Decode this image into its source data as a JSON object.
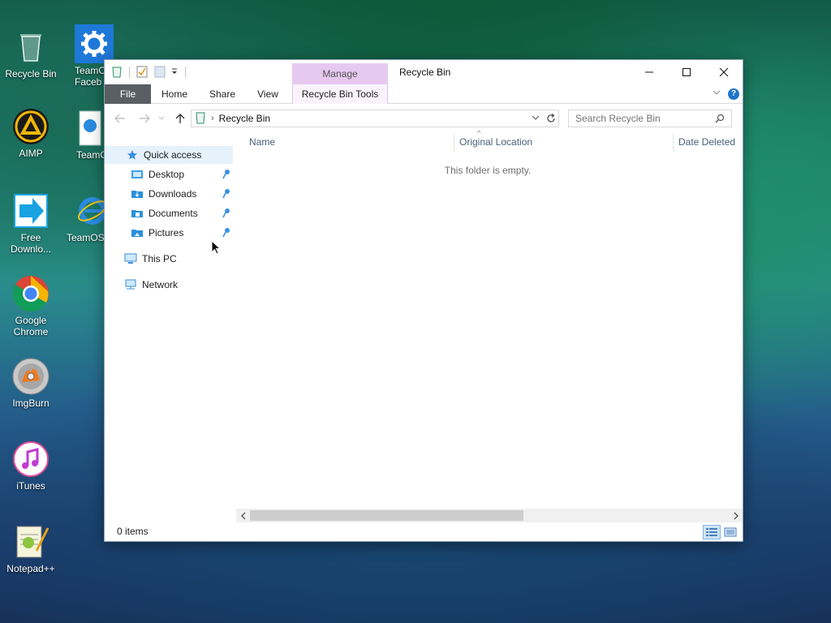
{
  "desktop": {
    "icons": [
      {
        "label": "Recycle Bin"
      },
      {
        "label": "TeamO\nFaceb"
      },
      {
        "label": "AIMP"
      },
      {
        "label": "TeamO"
      },
      {
        "label": "Free\nDownlo..."
      },
      {
        "label": "TeamOS"
      },
      {
        "label": "Google\nChrome"
      },
      {
        "label": "ImgBurn"
      },
      {
        "label": "iTunes"
      },
      {
        "label": "Notepad++"
      }
    ]
  },
  "window": {
    "title": "Recycle Bin",
    "context_tab_group": "Manage",
    "ribbon": {
      "tabs": [
        "File",
        "Home",
        "Share",
        "View",
        "Recycle Bin Tools"
      ]
    },
    "address": {
      "crumb": "Recycle Bin"
    },
    "search": {
      "placeholder": "Search Recycle Bin"
    },
    "nav": {
      "quick_access": "Quick access",
      "items": [
        "Desktop",
        "Downloads",
        "Documents",
        "Pictures"
      ],
      "this_pc": "This PC",
      "network": "Network"
    },
    "columns": [
      "Name",
      "Original Location",
      "Date Deleted"
    ],
    "empty_message": "This folder is empty.",
    "status": {
      "item_count": "0 items"
    }
  },
  "colors": {
    "file_tab": "#5a5f66",
    "context_tab": "#e7c9f0",
    "selection": "#e5f1fb",
    "accent": "#1f74c9"
  }
}
